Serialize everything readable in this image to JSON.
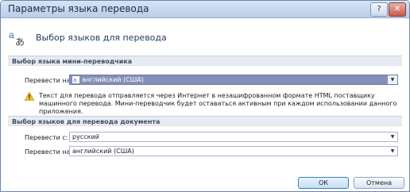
{
  "window": {
    "title": "Параметры языка перевода",
    "help_glyph": "?",
    "close_glyph": "✕"
  },
  "header": {
    "title": "Выбор языков для перевода",
    "icon": "translate-icon"
  },
  "mini": {
    "section_title": "Выбор языка мини-переводчика",
    "translate_to_label": "Перевести на:",
    "translate_to_value": "английский (США)",
    "warning": "Текст для перевода отправляется через Интернет в незашифрованном формате HTML поставщику машинного перевода. Мини-переводчик будет оставаться активным при каждом использовании данного приложения."
  },
  "document": {
    "section_title": "Выбор языков для перевода документа",
    "from_label": "Перевести с:",
    "from_value": "русский",
    "to_label": "Перевести на:",
    "to_value": "английский (США)"
  },
  "buttons": {
    "ok": "ОК",
    "cancel": "Отмена"
  },
  "dropdown_glyph": "▼"
}
